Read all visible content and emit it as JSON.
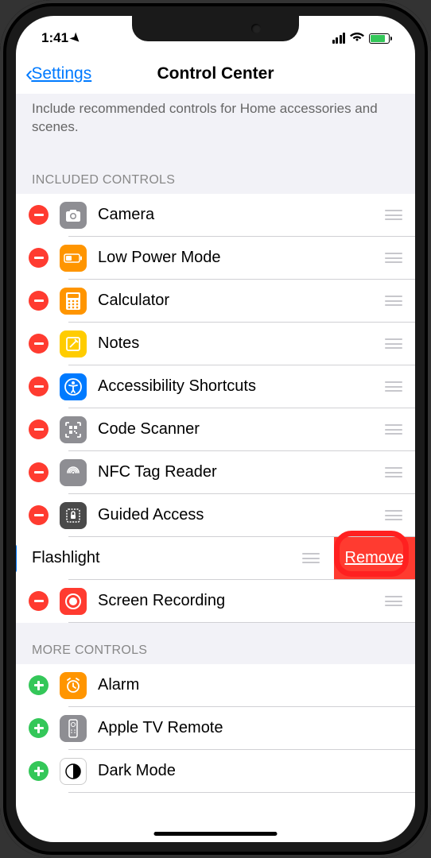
{
  "status": {
    "time": "1:41"
  },
  "nav": {
    "back_label": "Settings",
    "title": "Control Center"
  },
  "description": "Include recommended controls for Home accessories and scenes.",
  "sections": {
    "included_header": "INCLUDED CONTROLS",
    "more_header": "MORE CONTROLS"
  },
  "included": {
    "camera": "Camera",
    "lowpower": "Low Power Mode",
    "calculator": "Calculator",
    "notes": "Notes",
    "accessibility": "Accessibility Shortcuts",
    "codescanner": "Code Scanner",
    "nfc": "NFC Tag Reader",
    "guided": "Guided Access",
    "flashlight": "Flashlight",
    "screenrec": "Screen Recording"
  },
  "more": {
    "alarm": "Alarm",
    "appletv": "Apple TV Remote",
    "darkmode": "Dark Mode"
  },
  "actions": {
    "remove": "Remove"
  }
}
